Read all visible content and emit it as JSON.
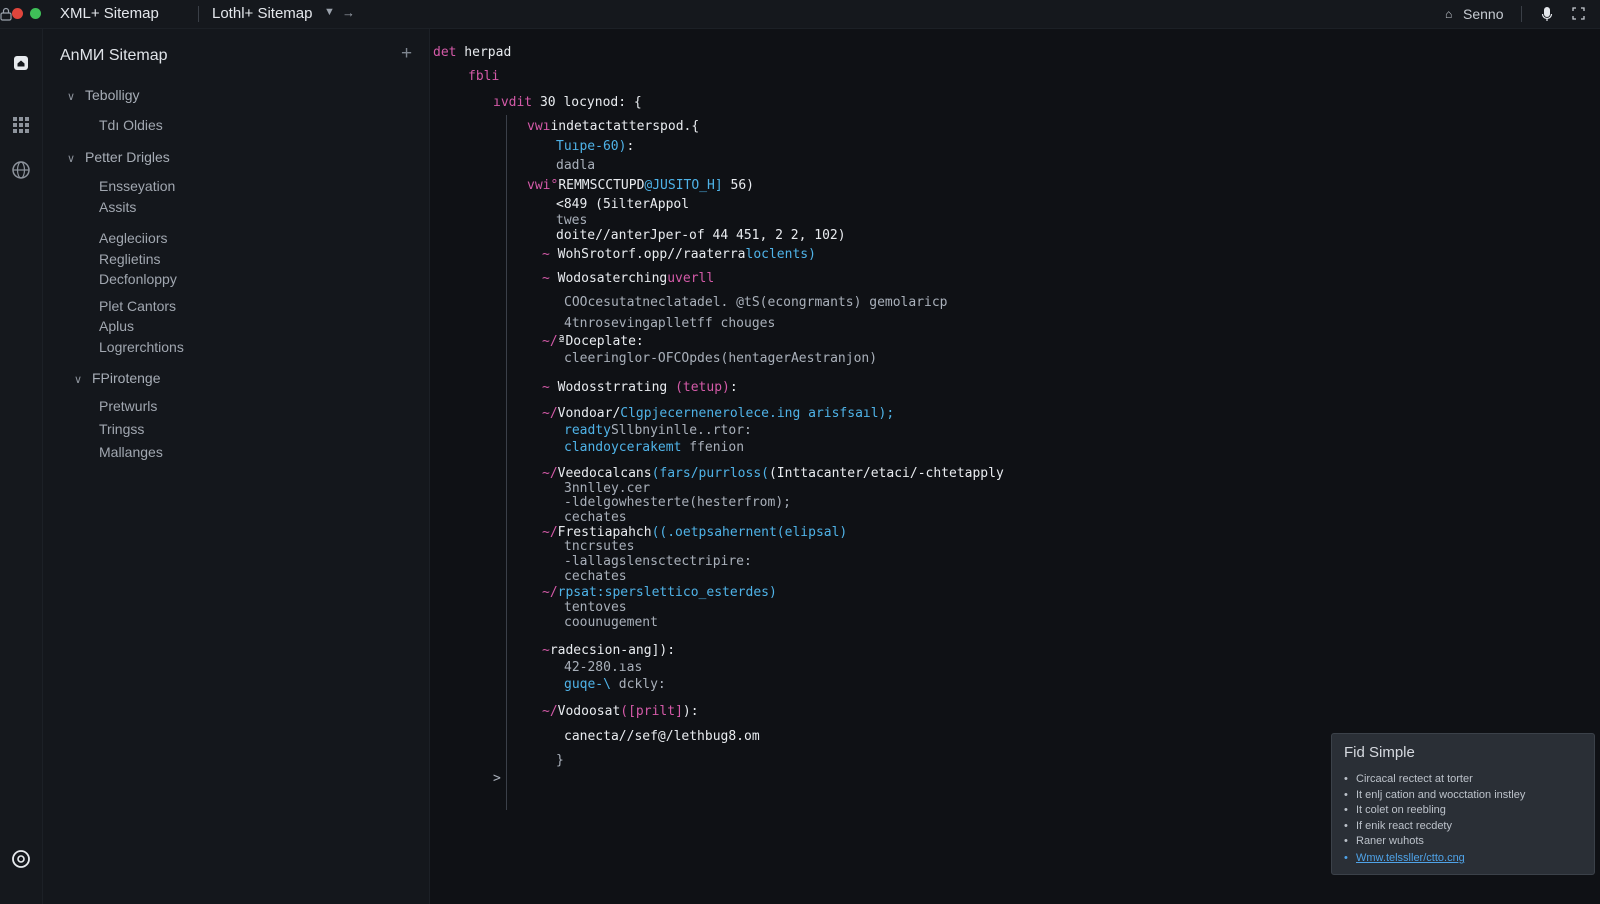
{
  "titlebar": {
    "title": "XML+ Sitemap",
    "second_title": "Lothl+ Sitemap",
    "right_label": "Senno",
    "icons": [
      "lock-icon",
      "chevron-down-icon",
      "arrow-right-icon",
      "home-icon",
      "mic-icon",
      "expand-icon"
    ]
  },
  "activity_bar": {
    "icons": [
      "home-icon",
      "grid-icon",
      "globe-icon",
      "account-icon"
    ]
  },
  "sidebar": {
    "title": "AnMИ Sitemap",
    "groups": [
      {
        "label": "Tebolligy",
        "items": [
          "Tdı Oldies"
        ]
      },
      {
        "label": "Petter Drigles",
        "items": [
          "Ensseyation",
          "Assits",
          "Aegleciiors",
          "Reglietins",
          "Decfonloppy",
          "Plet Cantors",
          "Aplus",
          "Logrerchtions"
        ]
      },
      {
        "label": "FPirotenge",
        "items": [
          "Pretwurls",
          "Tringss",
          "Mallanges"
        ]
      }
    ]
  },
  "editor": {
    "lines": [
      {
        "indent": 0,
        "parts": [
          {
            "t": "det",
            "c": "kw"
          },
          {
            "t": " herpad",
            "c": "fn"
          }
        ]
      },
      {
        "indent": 1,
        "parts": [
          {
            "t": "fbli",
            "c": "kw"
          }
        ]
      },
      {
        "indent": 2,
        "parts": [
          {
            "t": "ıvdit",
            "c": "kw"
          },
          {
            "t": " 30 locynod: {",
            "c": "fn"
          }
        ]
      },
      {
        "indent": 3,
        "parts": [
          {
            "t": "vwı",
            "c": "kw"
          },
          {
            "t": "indetactatterspod.{",
            "c": "fn"
          }
        ]
      },
      {
        "indent": 4,
        "parts": [
          {
            "t": "Tuıpe-60)",
            "c": "bl"
          },
          {
            "t": ":",
            "c": "fn"
          }
        ]
      },
      {
        "indent": 4,
        "parts": [
          {
            "t": "dadla",
            "c": "gy"
          }
        ]
      },
      {
        "indent": 3,
        "parts": [
          {
            "t": "vwi°",
            "c": "kw"
          },
          {
            "t": "REMMSCCTUPD",
            "c": "fn"
          },
          {
            "t": "@JUSITO_H]",
            "c": "bl"
          },
          {
            "t": " 56)",
            "c": "fn"
          }
        ]
      },
      {
        "indent": 4,
        "parts": [
          {
            "t": "<849 (5ilterAppol",
            "c": "fn"
          }
        ]
      },
      {
        "indent": 4,
        "parts": [
          {
            "t": "twes",
            "c": "gy"
          }
        ]
      },
      {
        "indent": 4,
        "parts": [
          {
            "t": "doite//anterJper-of 44 451, 2 2, 102)",
            "c": "fn"
          }
        ]
      },
      {
        "indent": 5,
        "parts": [
          {
            "t": "~ ",
            "c": "pk"
          },
          {
            "t": "WohSrotorf.opp//raaterra",
            "c": "fn"
          },
          {
            "t": "loclents)",
            "c": "bl"
          }
        ]
      },
      {
        "indent": 5,
        "parts": [
          {
            "t": "~ ",
            "c": "pk"
          },
          {
            "t": "Wodosaterching",
            "c": "fn"
          },
          {
            "t": "uverll",
            "c": "pk"
          }
        ]
      },
      {
        "indent": 6,
        "parts": [
          {
            "t": "COOcesutatneclatadel. @tS(econgrmants) gemolaricp",
            "c": "gy"
          }
        ]
      },
      {
        "indent": 6,
        "parts": [
          {
            "t": "4tnrosevingaplletff chouges",
            "c": "gy"
          }
        ]
      },
      {
        "indent": 5,
        "parts": [
          {
            "t": "~/",
            "c": "pk"
          },
          {
            "t": "ªDoceplate:",
            "c": "fn"
          }
        ]
      },
      {
        "indent": 6,
        "parts": [
          {
            "t": "cleeringlor-OFCOpdes(hentagerAestranjon)",
            "c": "gy"
          }
        ]
      },
      {
        "indent": 5,
        "parts": [
          {
            "t": "~ ",
            "c": "pk"
          },
          {
            "t": "Wodosstrrating ",
            "c": "fn"
          },
          {
            "t": "(tetup)",
            "c": "pk"
          },
          {
            "t": ":",
            "c": "fn"
          }
        ]
      },
      {
        "indent": 5,
        "parts": [
          {
            "t": "~/",
            "c": "pk"
          },
          {
            "t": "Vondoar/",
            "c": "fn"
          },
          {
            "t": "Clgpjecernenerolece.ing arisfsaıl);",
            "c": "bl"
          }
        ]
      },
      {
        "indent": 6,
        "parts": [
          {
            "t": "readty",
            "c": "bl"
          },
          {
            "t": "Sllbnyinlle..rtor:",
            "c": "gy"
          }
        ]
      },
      {
        "indent": 6,
        "parts": [
          {
            "t": "clandoycerakemt",
            "c": "bl"
          },
          {
            "t": " ffenion",
            "c": "gy"
          }
        ]
      },
      {
        "indent": 5,
        "parts": [
          {
            "t": "~/",
            "c": "pk"
          },
          {
            "t": "Veedocalcans",
            "c": "fn"
          },
          {
            "t": "(fars/purrloss(",
            "c": "bl"
          },
          {
            "t": "(Inttacanter/etaci/-chtetapply",
            "c": "fn"
          }
        ]
      },
      {
        "indent": 6,
        "parts": [
          {
            "t": "3nnlley.cer",
            "c": "gy"
          }
        ]
      },
      {
        "indent": 6,
        "parts": [
          {
            "t": "-ldelgowhesterte(hesterfrom);",
            "c": "gy"
          }
        ]
      },
      {
        "indent": 6,
        "parts": [
          {
            "t": "cechates",
            "c": "gy"
          }
        ]
      },
      {
        "indent": 5,
        "parts": [
          {
            "t": "~/",
            "c": "pk"
          },
          {
            "t": "Frestiapahch",
            "c": "fn"
          },
          {
            "t": "((.oetpsahernent(elipsal)",
            "c": "bl"
          }
        ]
      },
      {
        "indent": 6,
        "parts": [
          {
            "t": "tncrsutes",
            "c": "gy"
          }
        ]
      },
      {
        "indent": 6,
        "parts": [
          {
            "t": "-lallagslensctectripire:",
            "c": "gy"
          }
        ]
      },
      {
        "indent": 6,
        "parts": [
          {
            "t": "cechates",
            "c": "gy"
          }
        ]
      },
      {
        "indent": 5,
        "parts": [
          {
            "t": "~/",
            "c": "pk"
          },
          {
            "t": "rpsat:sperslettico_esterdes)",
            "c": "bl"
          }
        ]
      },
      {
        "indent": 6,
        "parts": [
          {
            "t": "tentoves",
            "c": "gy"
          }
        ]
      },
      {
        "indent": 6,
        "parts": [
          {
            "t": "coounugement",
            "c": "gy"
          }
        ]
      },
      {
        "indent": 5,
        "parts": [
          {
            "t": "~",
            "c": "pk"
          },
          {
            "t": "radecsion-ang]):",
            "c": "fn"
          }
        ]
      },
      {
        "indent": 6,
        "parts": [
          {
            "t": "42-280.ıas",
            "c": "gy"
          }
        ]
      },
      {
        "indent": 6,
        "parts": [
          {
            "t": "guqe-\\",
            "c": "bl"
          },
          {
            "t": " dckly:",
            "c": "gy"
          }
        ]
      },
      {
        "indent": 5,
        "parts": [
          {
            "t": "~/",
            "c": "pk"
          },
          {
            "t": "Vodoosat",
            "c": "fn"
          },
          {
            "t": "([prilt]",
            "c": "pk"
          },
          {
            "t": "):",
            "c": "fn"
          }
        ]
      },
      {
        "indent": 6,
        "parts": [
          {
            "t": "canecta//sef@/lethbug8.om",
            "c": "fn"
          }
        ]
      },
      {
        "indent": 4,
        "parts": [
          {
            "t": "}",
            "c": "gy"
          }
        ]
      },
      {
        "indent": 2,
        "parts": [
          {
            "t": ">",
            "c": "gy"
          }
        ]
      }
    ]
  },
  "info_card": {
    "title": "Fid Simple",
    "items": [
      "Circacal rectect at torter",
      "It enlj cation and wocctation instley",
      "It colet on reebling",
      "If enik react recdety",
      "Raner wuhots"
    ],
    "link": "Wmw.telssller/ctto.cng"
  }
}
